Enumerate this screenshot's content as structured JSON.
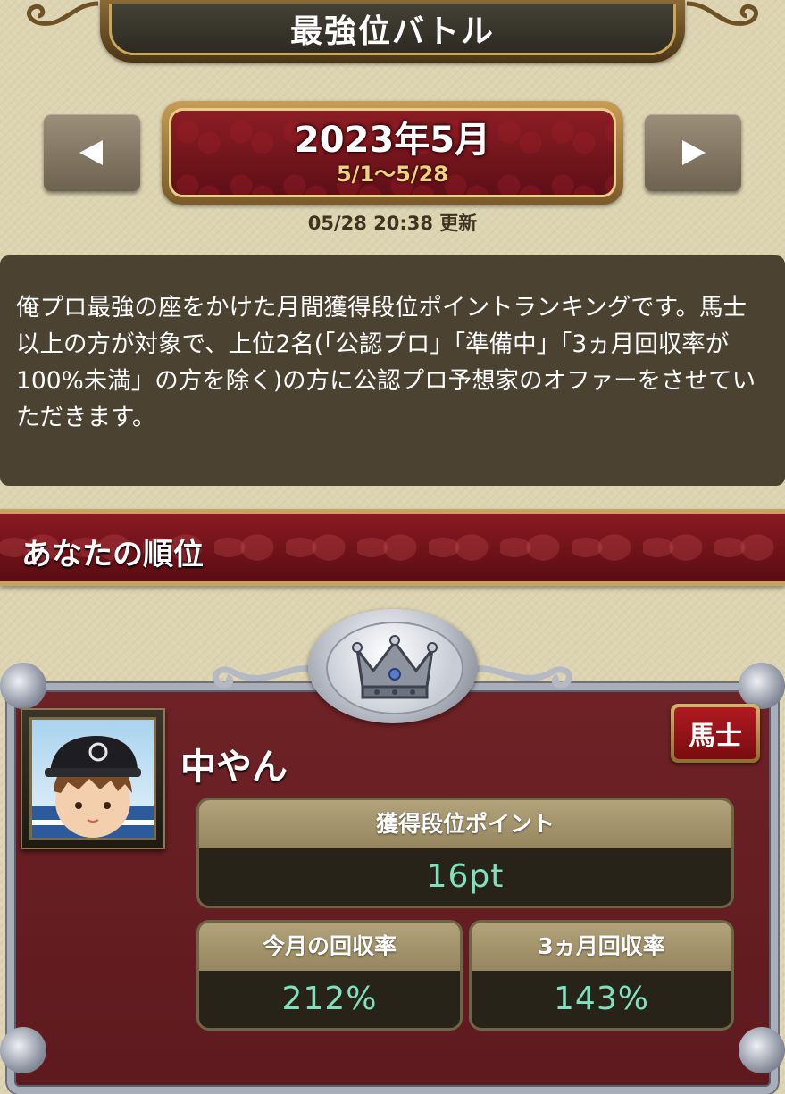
{
  "header": {
    "title": "最強位バトル"
  },
  "period_nav": {
    "prev_icon": "left-triangle-icon",
    "next_icon": "right-triangle-icon",
    "month": "2023年5月",
    "range": "5/1〜5/28",
    "updated": "05/28 20:38 更新"
  },
  "description": "俺プロ最強の座をかけた月間獲得段位ポイントランキングです。馬士以上の方が対象で、上位2名(「公認プロ」「準備中」「3ヵ月回収率が100%未満」の方を除く)の方に公認プロ予想家のオファーをさせていただきます。",
  "your_rank": {
    "section_title": "あなたの順位",
    "crown_icon": "silver-crown-icon",
    "player_name": "中やん",
    "rank_badge": "馬士",
    "stats": {
      "points_label": "獲得段位ポイント",
      "points_value": "16pt",
      "month_recovery_label": "今月の回収率",
      "month_recovery_value": "212%",
      "three_month_recovery_label": "3ヵ月回収率",
      "three_month_recovery_value": "143%"
    }
  },
  "colors": {
    "accent_red": "#7a111a",
    "stat_value_green": "#7fe1bd",
    "gold": "#c9a65a"
  }
}
